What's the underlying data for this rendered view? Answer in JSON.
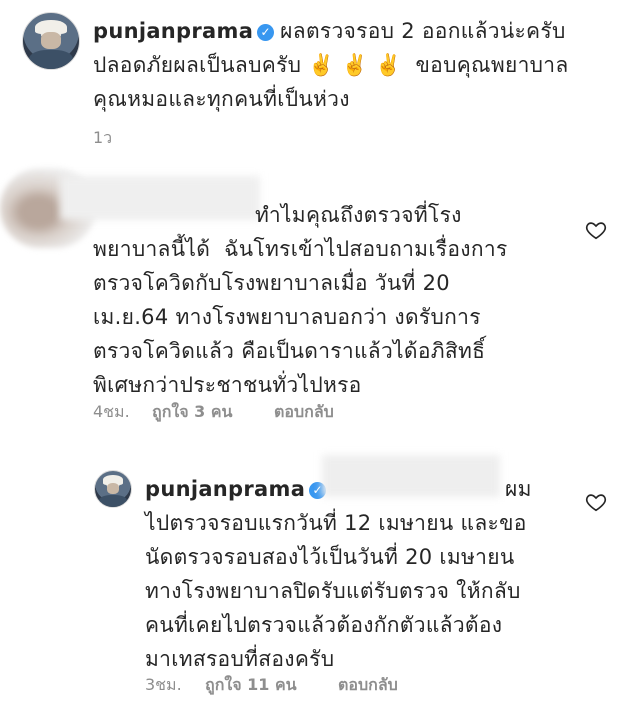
{
  "post": {
    "username": "punjanprama",
    "verified_icon": "verified-badge-icon",
    "lines": [
      "ผลตรวจรอบ 2 ออกแล้วน่ะครับ",
      "ปลอดภัยผลเป็นลบครับ ✌️ ✌️ ✌️  ขอบคุณพยาบาล",
      "คุณหมอและทุกคนที่เป็นห่วง"
    ],
    "time": "1ว"
  },
  "comments": [
    {
      "username_hidden": true,
      "lines": [
        "ทำไมคุณถึงตรวจที่โรง",
        "พยาบาลนี้ได้  ฉันโทรเข้าไปสอบถามเรื่องการ",
        "ตรวจโควิดกับโรงพยาบาลเมื่อ วันที่ 20",
        "เม.ย.64 ทางโรงพยาบาลบอกว่า งดรับการ",
        "ตรวจโควิดแล้ว คือเป็นดาราแล้วได้อภิสิทธิ์",
        "พิเศษกว่าประชาชนทั่วไปหรอ"
      ],
      "time": "4ชม.",
      "likes": "ถูกใจ 3 คน",
      "reply": "ตอบกลับ"
    },
    {
      "username": "punjanprama",
      "lines": [
        "ผม",
        "ไปตรวจรอบแรกวันที่ 12 เมษายน และขอ",
        "นัดตรวจรอบสองไว้เป็นวันที่ 20 เมษายน",
        "ทางโรงพยาบาลปิดรับแต่รับตรวจ ให้กลับ",
        "คนที่เคยไปตรวจแล้วต้องกักตัวแล้วต้อง",
        "มาเทสรอบที่สองครับ"
      ],
      "time": "3ชม.",
      "likes": "ถูกใจ 11 คน",
      "reply": "ตอบกลับ"
    }
  ],
  "icons": {
    "like": "heart-icon",
    "verified": "verified-badge-icon"
  },
  "colors": {
    "meta": "#8e8e8e",
    "verified": "#3897f0",
    "text": "#262626"
  }
}
